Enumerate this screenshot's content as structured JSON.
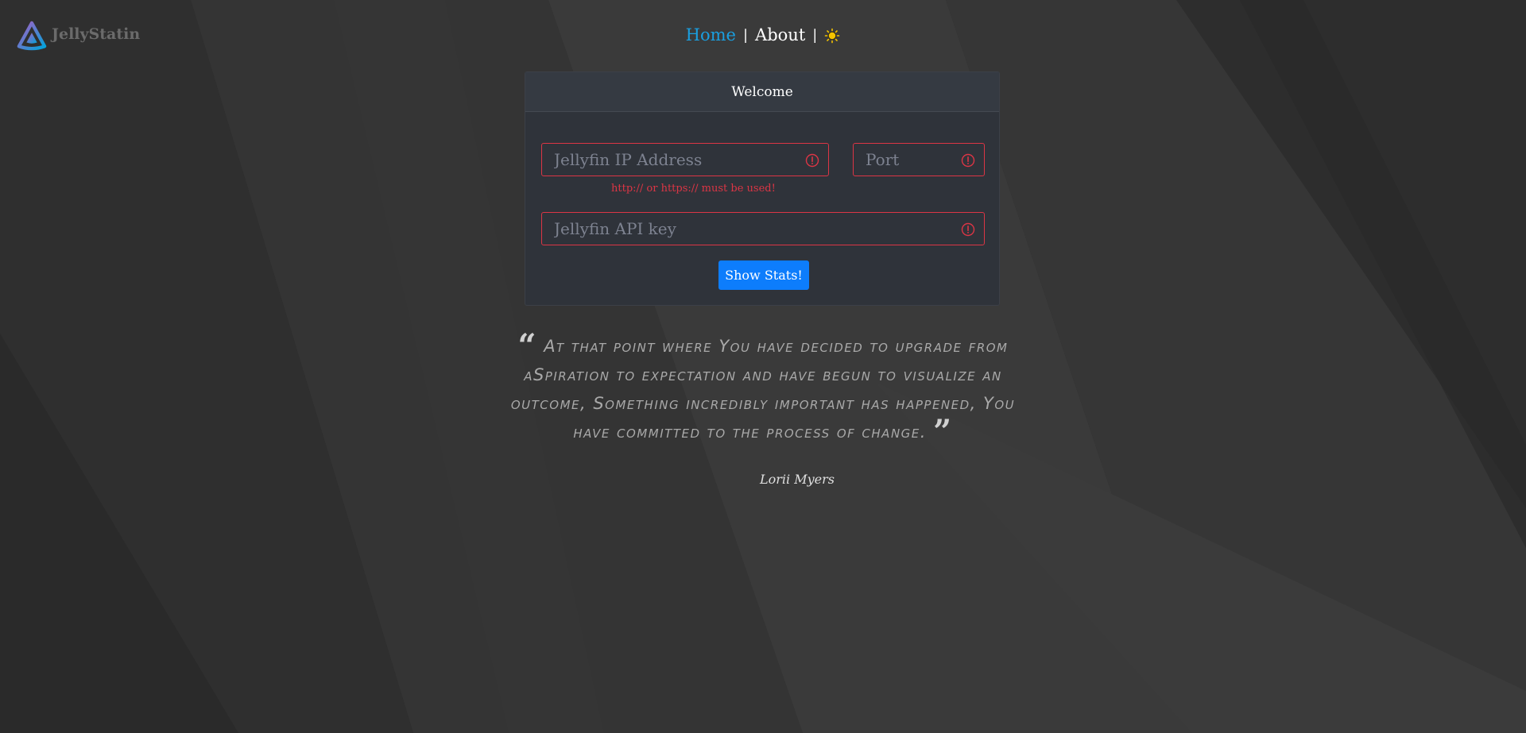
{
  "app": {
    "name": "JellyStatin"
  },
  "nav": {
    "home_label": "Home",
    "about_label": "About",
    "separator": "|",
    "theme_toggle_icon": "sun-icon"
  },
  "card": {
    "title": "Welcome",
    "ip_field": {
      "placeholder": "Jellyfin IP Address",
      "value": "",
      "error": "http:// or https:// must be used!"
    },
    "port_field": {
      "placeholder": "Port",
      "value": ""
    },
    "api_key_field": {
      "placeholder": "Jellyfin API key",
      "value": ""
    },
    "submit_label": "Show Stats!"
  },
  "quote": {
    "open_mark": "“",
    "text": "At that point where You have decided to upgrade from aSpiration to expectation and have begun to visualize an outcome, Something incredibly important has happened, You have committed to the process of change.",
    "close_mark": "”",
    "author": "Lorii Myers"
  },
  "colors": {
    "accent": "#0d7dfc",
    "nav_active": "#1a9fe0",
    "error": "#dc3545",
    "card_bg": "#2f333a",
    "page_bg": "#2e2e2e"
  }
}
